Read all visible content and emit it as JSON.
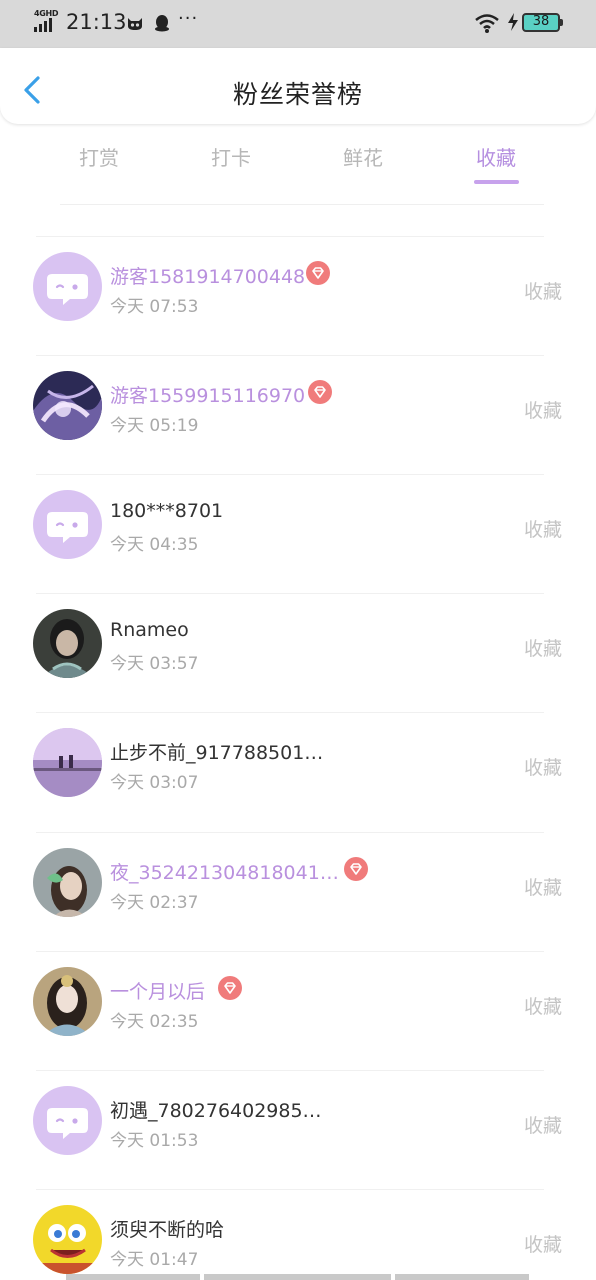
{
  "status_bar": {
    "network": "4GHD",
    "time": "21:13",
    "dots": "···",
    "battery": "38"
  },
  "header": {
    "title": "粉丝荣誉榜",
    "back_icon": "chevron-left-icon"
  },
  "colors": {
    "accent": "#b58fe0",
    "vip_name": "#b990de",
    "vip_badge": "#f07b7b",
    "muted": "#a9a9a9"
  },
  "tabs": [
    {
      "label": "打赏",
      "active": false
    },
    {
      "label": "打卡",
      "active": false
    },
    {
      "label": "鲜花",
      "active": false
    },
    {
      "label": "收藏",
      "active": true
    }
  ],
  "rows": [
    {
      "name": "游客1581914700448",
      "time": "今天 07:53",
      "action": "收藏",
      "vip": true,
      "avatar": "default-chat-avatar"
    },
    {
      "name": "游客1559915116970",
      "time": "今天 05:19",
      "action": "收藏",
      "vip": true,
      "avatar": "photo-avatar"
    },
    {
      "name": "180***8701",
      "time": "今天 04:35",
      "action": "收藏",
      "vip": false,
      "avatar": "default-chat-avatar"
    },
    {
      "name": "Rnameo",
      "time": "今天 03:57",
      "action": "收藏",
      "vip": false,
      "avatar": "photo-avatar"
    },
    {
      "name": "止步不前_917788501…",
      "time": "今天 03:07",
      "action": "收藏",
      "vip": false,
      "avatar": "photo-avatar"
    },
    {
      "name": "夜_352421304818041…",
      "time": "今天 02:37",
      "action": "收藏",
      "vip": true,
      "avatar": "photo-avatar"
    },
    {
      "name": "一个月以后",
      "time": "今天 02:35",
      "action": "收藏",
      "vip": true,
      "avatar": "photo-avatar"
    },
    {
      "name": "初遇_780276402985…",
      "time": "今天 01:53",
      "action": "收藏",
      "vip": false,
      "avatar": "default-chat-avatar"
    },
    {
      "name": "须臾不断的哈",
      "time": "今天 01:47",
      "action": "收藏",
      "vip": false,
      "avatar": "photo-avatar"
    }
  ]
}
